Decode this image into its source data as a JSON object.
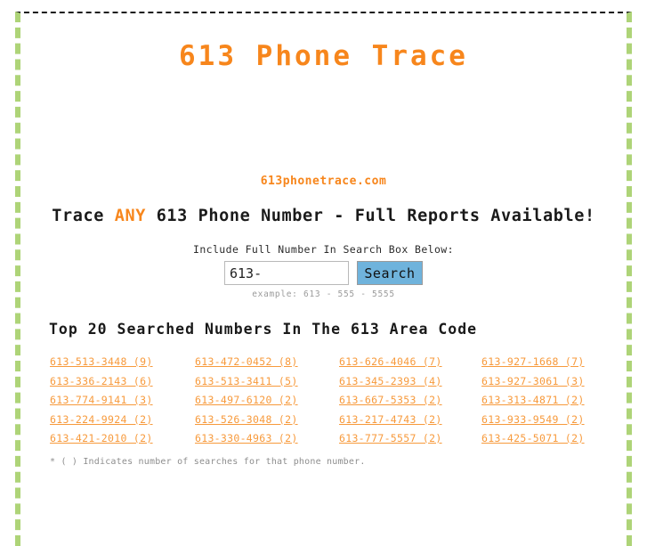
{
  "site": {
    "title": "613 Phone Trace",
    "domain": "613phonetrace.com"
  },
  "tagline": {
    "before": "Trace ",
    "highlight": "ANY",
    "after": " 613 Phone Number - Full Reports Available!"
  },
  "search": {
    "label": "Include Full Number In Search Box Below:",
    "input_value": "613-",
    "input_placeholder": "",
    "button_label": "Search",
    "example": "example: 613 - 555 - 5555"
  },
  "top_numbers": {
    "heading": "Top 20 Searched Numbers In The 613 Area Code",
    "items": [
      "613-513-3448  (9)",
      "613-472-0452  (8)",
      "613-626-4046  (7)",
      "613-927-1668  (7)",
      "613-336-2143  (6)",
      "613-513-3411  (5)",
      "613-345-2393  (4)",
      "613-927-3061  (3)",
      "613-774-9141  (3)",
      "613-497-6120  (2)",
      "613-667-5353  (2)",
      "613-313-4871  (2)",
      "613-224-9924  (2)",
      "613-526-3048  (2)",
      "613-217-4743  (2)",
      "613-933-9549  (2)",
      "613-421-2010  (2)",
      "613-330-4963  (2)",
      "613-777-5557  (2)",
      "613-425-5071  (2)"
    ],
    "footnote": "* ( ) Indicates number of searches for that phone number."
  },
  "colors": {
    "accent_orange": "#f7861c",
    "link_orange": "#f79a3c",
    "border_green": "#aed478",
    "button_blue": "#6fb3dc",
    "muted_grey": "#9b9b9b"
  }
}
